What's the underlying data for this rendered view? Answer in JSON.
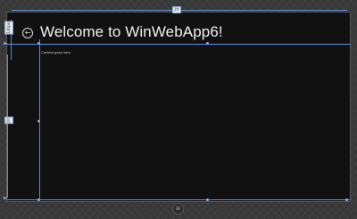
{
  "app": {
    "title": "Welcome to WinWebApp6!",
    "content": "Content goes here.",
    "back_glyph": "←",
    "back_icon": "back-arrow-icon"
  },
  "designer": {
    "top_measure": "1fr",
    "left_top_measure": "140px",
    "left_body_measure": "1fr",
    "start_glyph": "⊞",
    "start_icon": "windows-start-icon",
    "guide_color": "#5b8fd6"
  }
}
